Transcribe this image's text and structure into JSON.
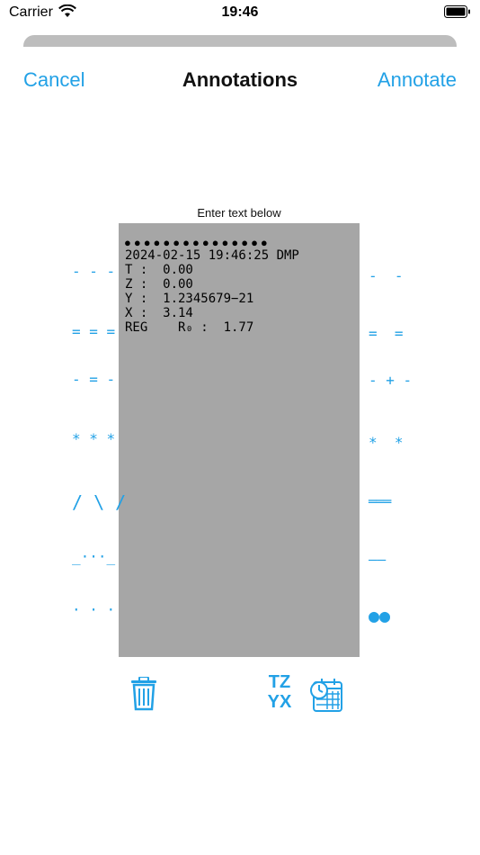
{
  "status": {
    "carrier": "Carrier",
    "time": "19:46"
  },
  "nav": {
    "cancel": "Cancel",
    "title": "Annotations",
    "annotate": "Annotate"
  },
  "hint": "Enter text below",
  "receipt": {
    "dots": "●●●●●●●●●●●●●●●",
    "lines": [
      "2024-02-15 19:46:25 DMP",
      "T :  0.00",
      "Z :  0.00",
      "Y :  1.2345679−21",
      "X :  3.14",
      "REG    R₀ :  1.77"
    ]
  },
  "left_marks": [
    "- - -",
    "= = =",
    "- = -",
    "* * *",
    "/ \\ /",
    "_···_",
    "· · ·"
  ],
  "right_marks": [
    "-  -",
    "=  =",
    "- + -",
    "*  *",
    "═══",
    "——",
    "●●"
  ],
  "toolbar": {
    "tz_label_top": "TZ",
    "tz_label_bottom": "YX"
  },
  "colors": {
    "accent": "#22a1e6",
    "receipt_bg": "#a6a6a6"
  },
  "icons": [
    "wifi-icon",
    "battery-icon",
    "trash-icon",
    "tz-yx-icon",
    "calendar-clock-icon"
  ]
}
